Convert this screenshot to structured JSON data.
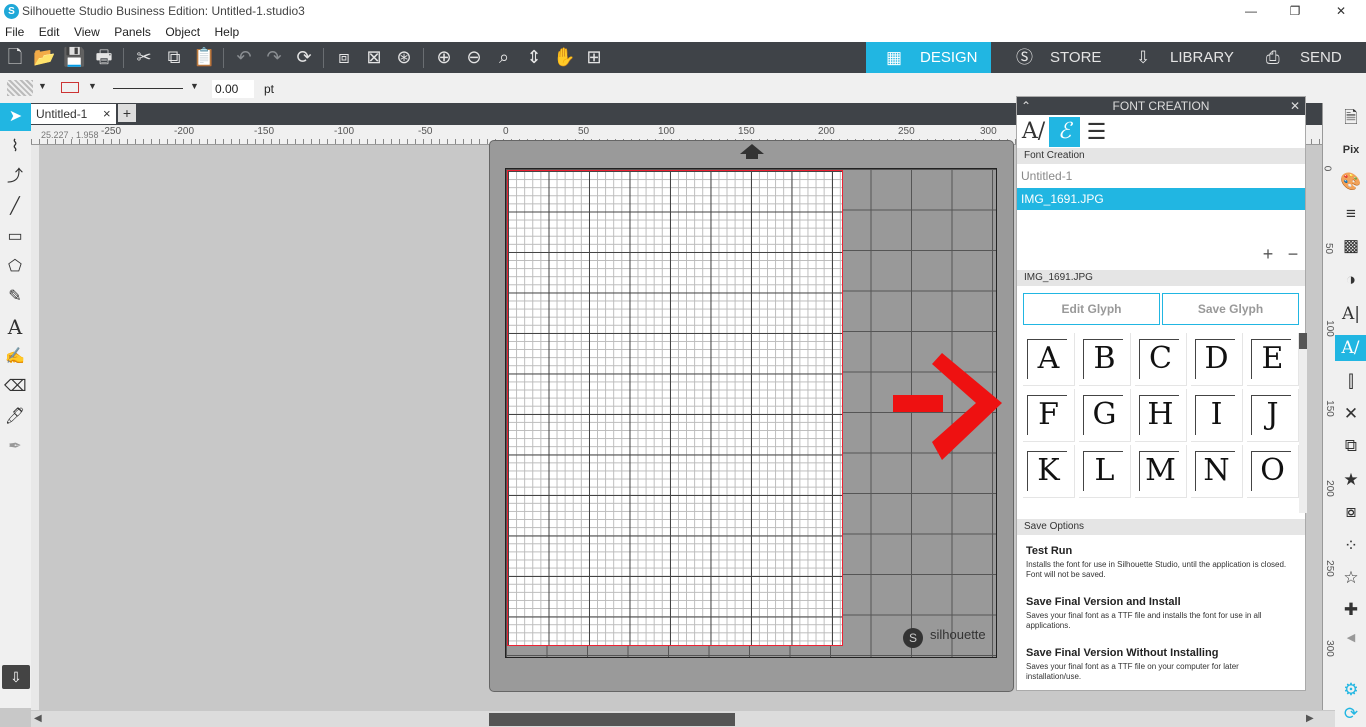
{
  "window": {
    "title": "Silhouette Studio Business Edition: Untitled-1.studio3",
    "logo": "S",
    "min": "—",
    "restore": "❐",
    "close": "✕"
  },
  "menu": [
    "File",
    "Edit",
    "View",
    "Panels",
    "Object",
    "Help"
  ],
  "navtabs": {
    "design": "DESIGN",
    "store": "STORE",
    "library": "LIBRARY",
    "send": "SEND"
  },
  "propbar": {
    "line_width": "0.00",
    "unit": "pt"
  },
  "document": {
    "tab": "Untitled-1",
    "close": "×",
    "add": "+",
    "cursor_coords": "25.227 , 1.958"
  },
  "ruler_top": [
    "-250",
    "-200",
    "-150",
    "-100",
    "-50",
    "0",
    "50",
    "100",
    "150",
    "200",
    "250",
    "300"
  ],
  "ruler_right": [
    "0",
    "50",
    "100",
    "150",
    "200",
    "250",
    "300"
  ],
  "mat": {
    "brand": "silhouette",
    "brand_mark": "S"
  },
  "panel": {
    "title": "FONT CREATION",
    "section_font": "Font Creation",
    "items": [
      "Untitled-1",
      "IMG_1691.JPG"
    ],
    "selected_section": "IMG_1691.JPG",
    "edit_glyph": "Edit Glyph",
    "save_glyph": "Save Glyph",
    "glyphs": [
      "A",
      "B",
      "C",
      "D",
      "E",
      "F",
      "G",
      "H",
      "I",
      "J",
      "K",
      "L",
      "M",
      "N",
      "O"
    ],
    "save_options_header": "Save Options",
    "options": [
      {
        "title": "Test Run",
        "desc": "Installs the font for use in Silhouette Studio, until the application is closed. Font will not be saved."
      },
      {
        "title": "Save Final Version and Install",
        "desc": "Saves your final font as a TTF file and installs the font for use in all applications."
      },
      {
        "title": "Save Final Version Without Installing",
        "desc": "Saves your final font as a TTF file on your computer for later installation/use."
      }
    ]
  },
  "colors": {
    "accent": "#21b6e2",
    "toolbar": "#3f4348",
    "red_arrow": "#ee1111"
  }
}
